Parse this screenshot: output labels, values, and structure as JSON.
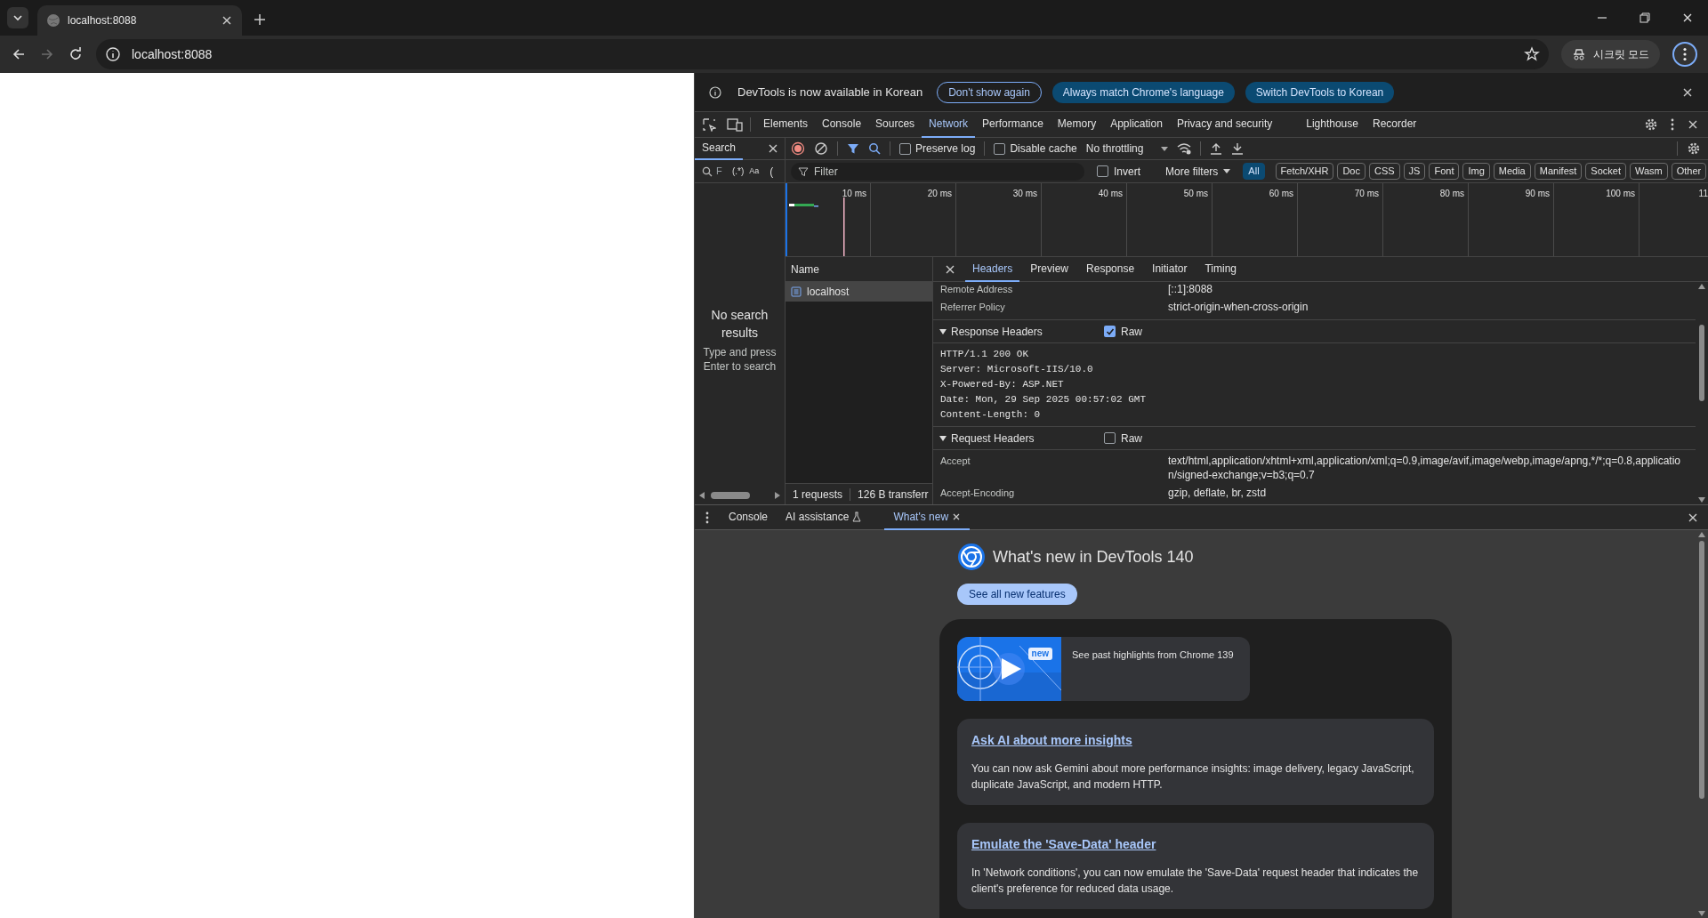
{
  "browser": {
    "tab": {
      "title": "localhost:8088"
    },
    "forward_disabled": true,
    "address": "localhost:8088",
    "profile_button": "시크릿 모드"
  },
  "infobar": {
    "message": "DevTools is now available in Korean",
    "buttons": [
      {
        "label": "Don't show again",
        "kind": "outline"
      },
      {
        "label": "Always match Chrome's language",
        "kind": "filled"
      },
      {
        "label": "Switch DevTools to Korean",
        "kind": "filled"
      }
    ]
  },
  "panel_tabs": [
    {
      "label": "Elements",
      "selected": false
    },
    {
      "label": "Console",
      "selected": false
    },
    {
      "label": "Sources",
      "selected": false
    },
    {
      "label": "Network",
      "selected": true
    },
    {
      "label": "Performance",
      "selected": false
    },
    {
      "label": "Memory",
      "selected": false
    },
    {
      "label": "Application",
      "selected": false
    },
    {
      "label": "Privacy and security",
      "selected": false
    },
    {
      "label": "Lighthouse",
      "selected": false
    },
    {
      "label": "Recorder",
      "selected": false
    }
  ],
  "search_panel": {
    "tab": "Search",
    "placeholder": "F",
    "regex": "(.*)",
    "match_case": "Aa",
    "cut_option": "(",
    "empty_title": "No search results",
    "empty_hint": "Type and press Enter to search"
  },
  "network_toolbar": {
    "preserve_log": {
      "label": "Preserve log",
      "checked": false
    },
    "disable_cache": {
      "label": "Disable cache",
      "checked": false
    },
    "throttling": "No throttling"
  },
  "filter_bar": {
    "placeholder": "Filter",
    "invert": {
      "label": "Invert",
      "checked": false
    },
    "more_filters": "More filters",
    "types": [
      {
        "label": "All",
        "selected": true
      },
      {
        "label": "Fetch/XHR",
        "selected": false
      },
      {
        "label": "Doc",
        "selected": false
      },
      {
        "label": "CSS",
        "selected": false
      },
      {
        "label": "JS",
        "selected": false
      },
      {
        "label": "Font",
        "selected": false
      },
      {
        "label": "Img",
        "selected": false
      },
      {
        "label": "Media",
        "selected": false
      },
      {
        "label": "Manifest",
        "selected": false
      },
      {
        "label": "Socket",
        "selected": false
      },
      {
        "label": "Wasm",
        "selected": false
      },
      {
        "label": "Other",
        "selected": false
      }
    ]
  },
  "timeline": {
    "ticks": [
      "10 ms",
      "20 ms",
      "30 ms",
      "40 ms",
      "50 ms",
      "60 ms",
      "70 ms",
      "80 ms",
      "90 ms",
      "100 ms",
      "11"
    ]
  },
  "requests": {
    "column": "Name",
    "rows": [
      {
        "name": "localhost",
        "selected": true
      }
    ],
    "summary": [
      "1 requests",
      "126 B transferr"
    ]
  },
  "details": {
    "tabs": [
      {
        "label": "Headers",
        "selected": true
      },
      {
        "label": "Preview",
        "selected": false
      },
      {
        "label": "Response",
        "selected": false
      },
      {
        "label": "Initiator",
        "selected": false
      },
      {
        "label": "Timing",
        "selected": false
      }
    ],
    "general": [
      {
        "name": "Remote Address",
        "value": "[::1]:8088"
      },
      {
        "name": "Referrer Policy",
        "value": "strict-origin-when-cross-origin"
      }
    ],
    "sections": [
      {
        "title": "Response Headers",
        "expanded": true,
        "raw_label": "Raw",
        "raw": true,
        "raw_lines": [
          "HTTP/1.1 200 OK",
          "Server: Microsoft-IIS/10.0",
          "X-Powered-By: ASP.NET",
          "Date: Mon, 29 Sep 2025 00:57:02 GMT",
          "Content-Length: 0"
        ]
      },
      {
        "title": "Request Headers",
        "expanded": true,
        "raw_label": "Raw",
        "raw": false,
        "headers": [
          {
            "name": "Accept",
            "value": "text/html,application/xhtml+xml,application/xml;q=0.9,image/avif,image/webp,image/apng,*/*;q=0.8,application/signed-exchange;v=b3;q=0.7"
          },
          {
            "name": "Accept-Encoding",
            "value": "gzip, deflate, br, zstd"
          }
        ]
      }
    ]
  },
  "drawer": {
    "tabs": [
      {
        "label": "Console",
        "selected": false,
        "experimental": false,
        "closable": false
      },
      {
        "label": "AI assistance",
        "selected": false,
        "experimental": true,
        "closable": false
      },
      {
        "label": "What's new",
        "selected": true,
        "experimental": false,
        "closable": true
      }
    ],
    "title": "What's new in DevTools 140",
    "see_all": "See all new features",
    "video": {
      "badge": "new",
      "caption": "See past highlights from Chrome 139"
    },
    "features": [
      {
        "title": "Ask AI about more insights",
        "text": "You can now ask Gemini about more performance insights: image delivery, legacy JavaScript, duplicate JavaScript, and modern HTTP."
      },
      {
        "title": "Emulate the 'Save-Data' header",
        "text": "In 'Network conditions', you can now emulate the 'Save-Data' request header that indicates the client's preference for reduced data usage."
      }
    ]
  }
}
